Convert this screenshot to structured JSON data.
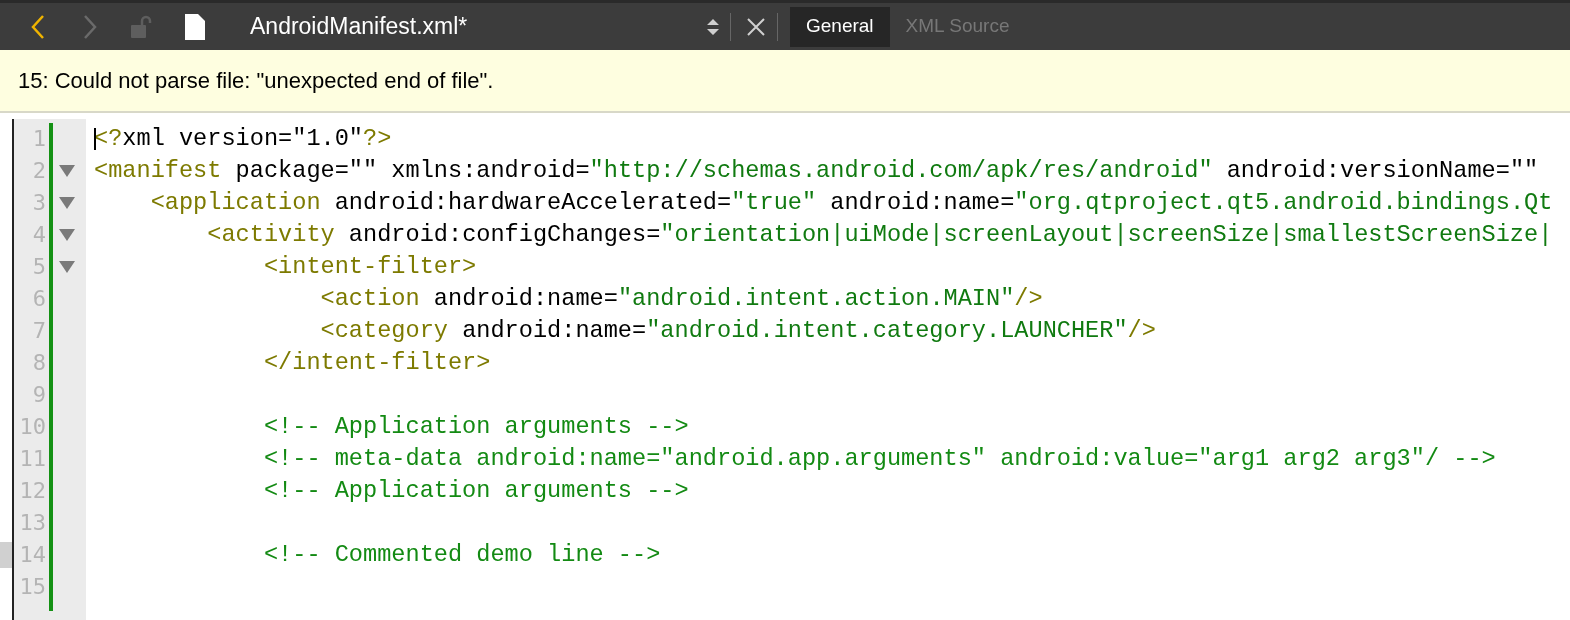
{
  "toolbar": {
    "title": "AndroidManifest.xml*",
    "back_enabled": true,
    "forward_enabled": false,
    "tabs": [
      {
        "label": "General",
        "selected": true
      },
      {
        "label": "XML Source",
        "selected": false
      }
    ]
  },
  "error_bar": {
    "message": "15: Could not parse file: \"unexpected end of file\"."
  },
  "editor": {
    "lines": [
      {
        "number": "1",
        "foldable": false,
        "marked": false,
        "cursor": true,
        "tokens": [
          {
            "kind": "tag",
            "text": "<?"
          },
          {
            "kind": "attr",
            "text": "xml version=\"1.0\""
          },
          {
            "kind": "tag",
            "text": "?>"
          }
        ]
      },
      {
        "number": "2",
        "foldable": true,
        "marked": false,
        "cursor": false,
        "tokens": [
          {
            "kind": "tag",
            "text": "<manifest"
          },
          {
            "kind": "attr",
            "text": " package=\"\" xmlns:android="
          },
          {
            "kind": "value",
            "text": "\"http://schemas.android.com/apk/res/android\""
          },
          {
            "kind": "attr",
            "text": " android:versionName=\"\""
          }
        ]
      },
      {
        "number": "3",
        "foldable": true,
        "marked": false,
        "cursor": false,
        "tokens": [
          {
            "kind": "tag",
            "text": "    <application"
          },
          {
            "kind": "attr",
            "text": " android:hardwareAccelerated="
          },
          {
            "kind": "value",
            "text": "\"true\""
          },
          {
            "kind": "attr",
            "text": " android:name="
          },
          {
            "kind": "value",
            "text": "\"org.qtproject.qt5.android.bindings.Qt"
          }
        ]
      },
      {
        "number": "4",
        "foldable": true,
        "marked": false,
        "cursor": false,
        "tokens": [
          {
            "kind": "tag",
            "text": "        <activity"
          },
          {
            "kind": "attr",
            "text": " android:configChanges="
          },
          {
            "kind": "value",
            "text": "\"orientation|uiMode|screenLayout|screenSize|smallestScreenSize|"
          }
        ]
      },
      {
        "number": "5",
        "foldable": true,
        "marked": false,
        "cursor": false,
        "tokens": [
          {
            "kind": "tag",
            "text": "            <intent-filter>"
          }
        ]
      },
      {
        "number": "6",
        "foldable": false,
        "marked": false,
        "cursor": false,
        "tokens": [
          {
            "kind": "tag",
            "text": "                <action"
          },
          {
            "kind": "attr",
            "text": " android:name="
          },
          {
            "kind": "value",
            "text": "\"android.intent.action.MAIN\""
          },
          {
            "kind": "tag",
            "text": "/>"
          }
        ]
      },
      {
        "number": "7",
        "foldable": false,
        "marked": false,
        "cursor": false,
        "tokens": [
          {
            "kind": "tag",
            "text": "                <category"
          },
          {
            "kind": "attr",
            "text": " android:name="
          },
          {
            "kind": "value",
            "text": "\"android.intent.category.LAUNCHER\""
          },
          {
            "kind": "tag",
            "text": "/>"
          }
        ]
      },
      {
        "number": "8",
        "foldable": false,
        "marked": false,
        "cursor": false,
        "tokens": [
          {
            "kind": "tag",
            "text": "            </intent-filter>"
          }
        ]
      },
      {
        "number": "9",
        "foldable": false,
        "marked": false,
        "cursor": false
      },
      {
        "number": "10",
        "foldable": false,
        "marked": false,
        "cursor": false,
        "tokens": [
          {
            "kind": "comment",
            "text": "            <!-- Application arguments -->"
          }
        ]
      },
      {
        "number": "11",
        "foldable": false,
        "marked": false,
        "cursor": false,
        "tokens": [
          {
            "kind": "comment",
            "text": "            <!-- meta-data android:name=\"android.app.arguments\" android:value=\"arg1 arg2 arg3\"/ -->"
          }
        ]
      },
      {
        "number": "12",
        "foldable": false,
        "marked": false,
        "cursor": false,
        "tokens": [
          {
            "kind": "comment",
            "text": "            <!-- Application arguments -->"
          }
        ]
      },
      {
        "number": "13",
        "foldable": false,
        "marked": false,
        "cursor": false
      },
      {
        "number": "14",
        "foldable": false,
        "marked": true,
        "cursor": false,
        "tokens": [
          {
            "kind": "comment",
            "text": "            <!-- Commented demo line -->"
          }
        ]
      },
      {
        "number": "15",
        "foldable": false,
        "marked": false,
        "cursor": false
      }
    ]
  }
}
